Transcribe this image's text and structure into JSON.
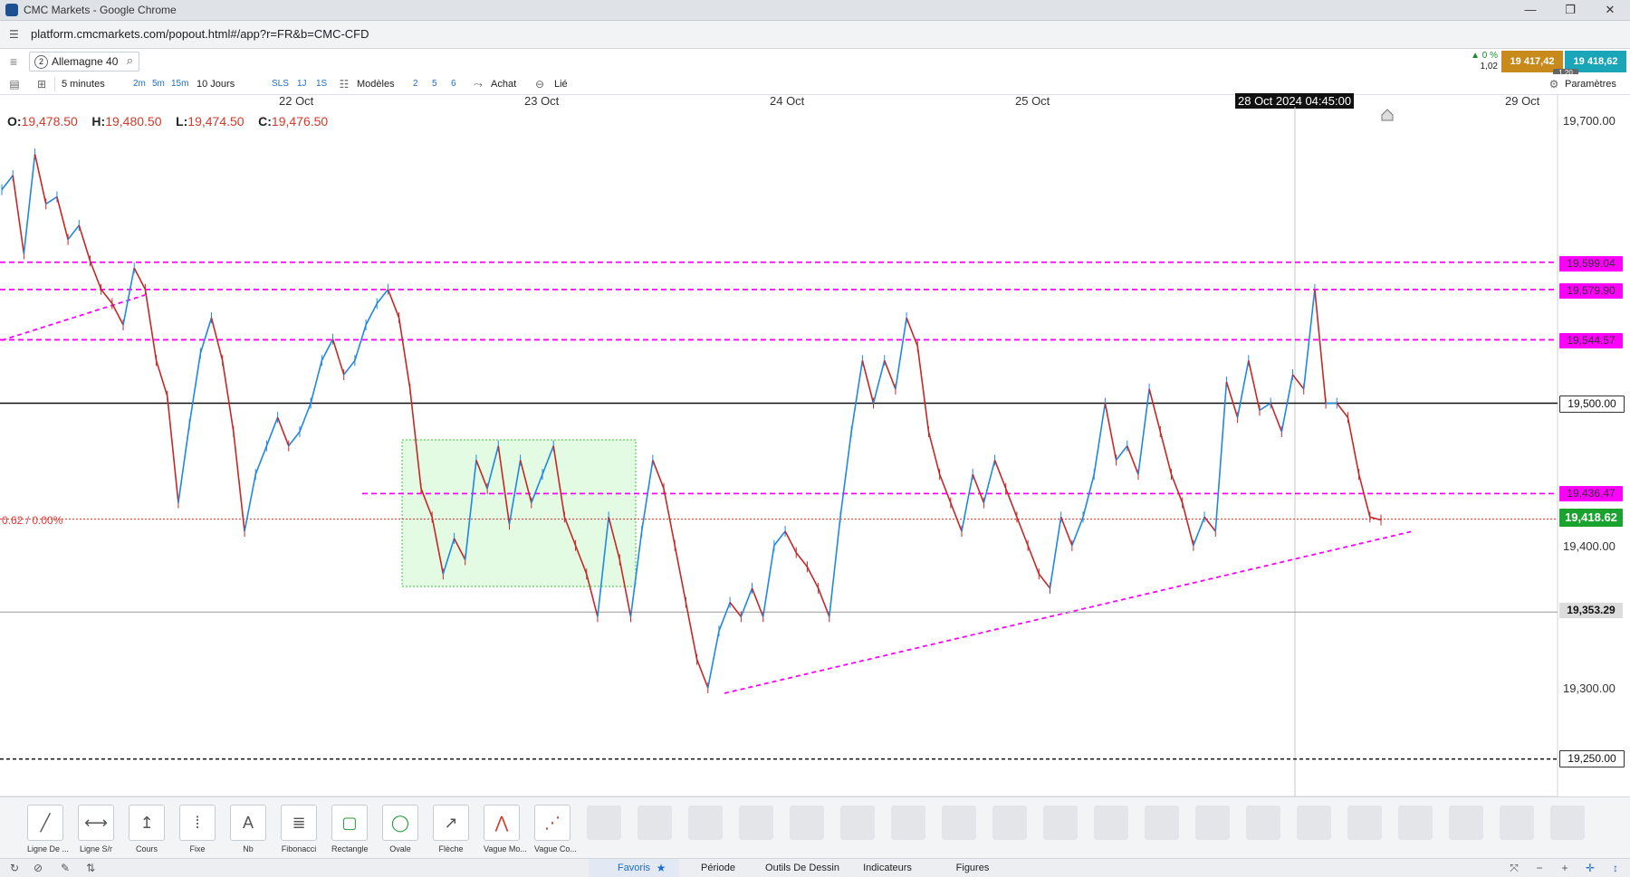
{
  "window": {
    "title": "CMC Markets - Google Chrome",
    "minimize": "—",
    "maximize": "❐",
    "close": "✕"
  },
  "address": {
    "url": "platform.cmcmarkets.com/popout.html#/app?r=FR&b=CMC-CFD"
  },
  "instrument": {
    "badge": "2",
    "name": "Allemagne 40",
    "change_pct": "▲ 0 %",
    "change_abs": "1,02",
    "sell_price": "19 417,42",
    "buy_price": "19 418,62",
    "spread": "1,20"
  },
  "toolbar": {
    "interval": "5 minutes",
    "quick_intervals": [
      "2m",
      "5m",
      "15m"
    ],
    "range": "10 Jours",
    "range_buttons": [
      "SLS",
      "1J",
      "1S"
    ],
    "templates": "Modèles",
    "template_numbers": [
      "2",
      "5",
      "6"
    ],
    "buy": "Achat",
    "linked": "Lié",
    "settings": "Paramètres"
  },
  "colors": {
    "magenta": "#ff00ff",
    "price_red": "#e53935",
    "current_green": "#1aa32f",
    "sell_orange": "#c98a1c",
    "buy_teal": "#1aa6b8",
    "candle_up": "#1e88e5",
    "candle_down": "#c62828"
  },
  "chart_data": {
    "type": "line",
    "ohlc": {
      "o_label": "O:",
      "o": "19,478.50",
      "h_label": "H:",
      "h": "19,480.50",
      "l_label": "L:",
      "l": "19,474.50",
      "c_label": "C:",
      "c": "19,476.50"
    },
    "x_labels": [
      "22 Oct",
      "23 Oct",
      "24 Oct",
      "25 Oct",
      "29 Oct"
    ],
    "crosshair_time": "28 Oct 2024 04:45:00",
    "y_ticks": [
      "19,700.00",
      "19,400.00",
      "19,300.00"
    ],
    "ylim": [
      19225,
      19720
    ],
    "series": [
      {
        "values": [
          19650,
          19660,
          19605,
          19675,
          19640,
          19645,
          19615,
          19625,
          19600,
          19580,
          19570,
          19555,
          19595,
          19580,
          19530,
          19505,
          19430,
          19485,
          19535,
          19560,
          19530,
          19480,
          19410,
          19450,
          19470,
          19490,
          19470,
          19480,
          19500,
          19530,
          19545,
          19520,
          19530,
          19555,
          19570,
          19580,
          19560,
          19510,
          19440,
          19420,
          19380,
          19405,
          19390,
          19460,
          19440,
          19470,
          19415,
          19460,
          19430,
          19450,
          19470,
          19420,
          19400,
          19380,
          19350,
          19420,
          19390,
          19350,
          19410,
          19460,
          19440,
          19400,
          19360,
          19320,
          19300,
          19340,
          19360,
          19350,
          19370,
          19350,
          19400,
          19410,
          19395,
          19385,
          19370,
          19350,
          19420,
          19480,
          19530,
          19500,
          19530,
          19510,
          19560,
          19540,
          19480,
          19450,
          19430,
          19410,
          19450,
          19430,
          19460,
          19440,
          19420,
          19400,
          19380,
          19370,
          19420,
          19400,
          19420,
          19450,
          19500,
          19460,
          19470,
          19450,
          19510,
          19480,
          19450,
          19430,
          19400,
          19420,
          19410,
          19515,
          19490,
          19530,
          19495,
          19500,
          19480,
          19520,
          19510,
          19580,
          19500,
          19500,
          19490,
          19450,
          19420,
          19418
        ]
      }
    ],
    "levels": [
      {
        "label": "19,599.04",
        "value": 19599.04,
        "style": "magenta"
      },
      {
        "label": "19,579.90",
        "value": 19579.9,
        "style": "magenta"
      },
      {
        "label": "19,544.57",
        "value": 19544.57,
        "style": "magenta"
      },
      {
        "label": "19,500.00",
        "value": 19500.0,
        "style": "black"
      },
      {
        "label": "19,436.47",
        "value": 19436.47,
        "style": "magenta"
      },
      {
        "label": "19,418.62",
        "value": 19418.62,
        "style": "current"
      },
      {
        "label": "19,353.29",
        "value": 19353.29,
        "style": "grey"
      },
      {
        "label": "19,250.00",
        "value": 19250.0,
        "style": "black-dashed"
      }
    ],
    "fib_label": "0.62 / 0.00%"
  },
  "tools": [
    {
      "label": "Ligne De ...",
      "icon": "trend-line-icon"
    },
    {
      "label": "Ligne S/r",
      "icon": "support-line-icon"
    },
    {
      "label": "Cours",
      "icon": "price-line-icon"
    },
    {
      "label": "Fixe",
      "icon": "vertical-line-icon"
    },
    {
      "label": "Nb",
      "icon": "text-icon"
    },
    {
      "label": "Fibonacci",
      "icon": "fibonacci-icon"
    },
    {
      "label": "Rectangle",
      "icon": "rectangle-icon"
    },
    {
      "label": "Ovale",
      "icon": "ellipse-icon"
    },
    {
      "label": "Flèche",
      "icon": "arrow-icon"
    },
    {
      "label": "Vague Mo...",
      "icon": "wave-icon"
    },
    {
      "label": "Vague Co...",
      "icon": "corrective-wave-icon"
    }
  ],
  "bottom_tabs": [
    "Favoris",
    "Période",
    "Outils De Dessin",
    "Indicateurs",
    "Figures"
  ]
}
